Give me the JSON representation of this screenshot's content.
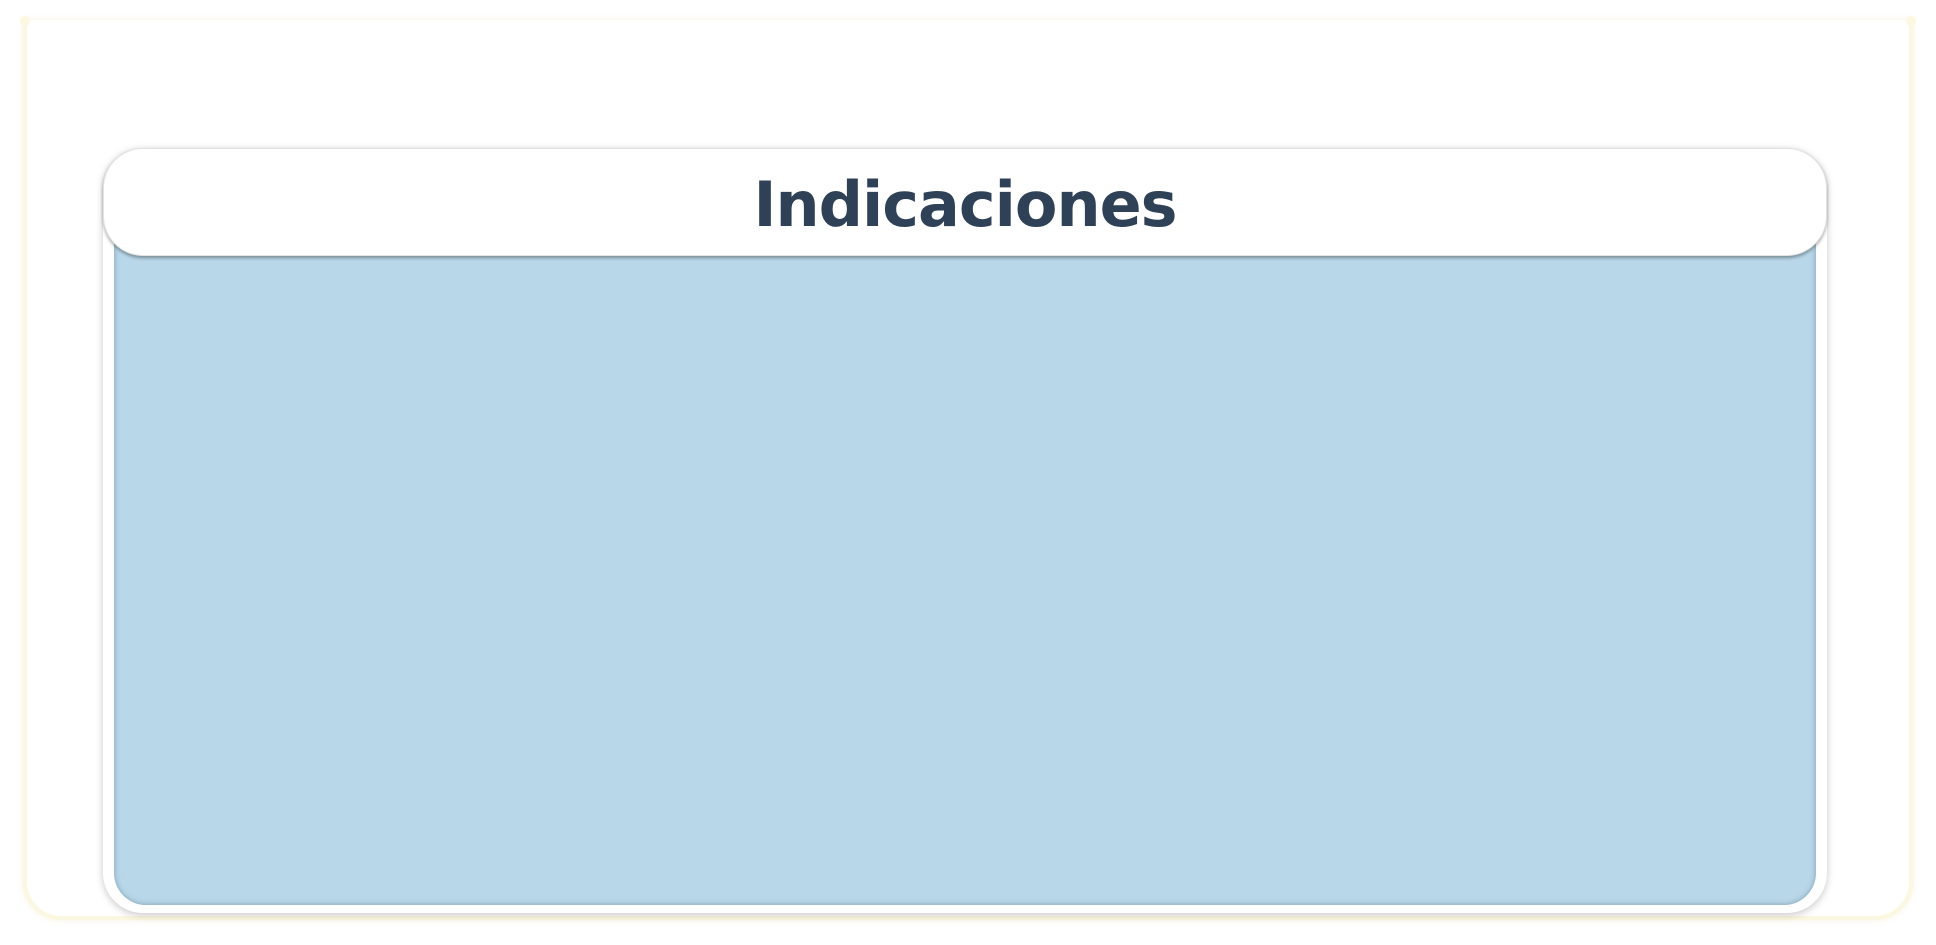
{
  "page": {
    "title": "Indicaciones"
  },
  "colors": {
    "title_text": "#2f4157",
    "panel_background": "#b8d7e9",
    "card_background": "#ffffff",
    "outer_frame": "#fbf7e0"
  }
}
